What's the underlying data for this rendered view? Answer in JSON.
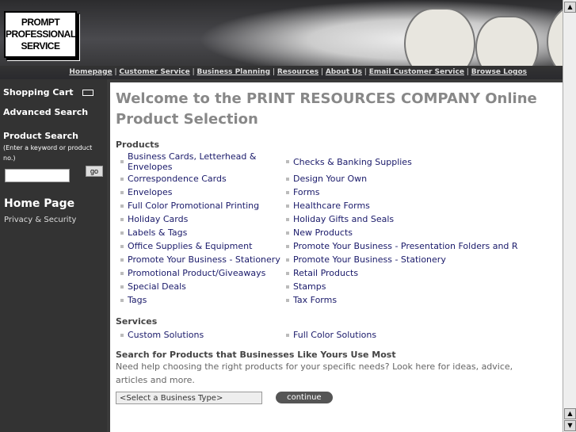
{
  "logo": {
    "text": [
      "PROMPT",
      "PROFESSIONAL",
      "SERVICE"
    ]
  },
  "nav": [
    "Homepage",
    "Customer Service",
    "Business Planning",
    "Resources",
    "About Us",
    "Email Customer Service",
    "Browse Logos"
  ],
  "sidebar": {
    "cart": "Shopping Cart",
    "advanced": "Advanced Search",
    "search_title": "Product Search",
    "search_hint": "(Enter a keyword or product no.)",
    "search_value": "",
    "go": "go",
    "home": "Home Page",
    "privacy": "Privacy & Security"
  },
  "main": {
    "title": "Welcome to the PRINT RESOURCES COMPANY Online Product Selection",
    "products_heading": "Products",
    "products": [
      "Business Cards, Letterhead & Envelopes",
      "Checks & Banking Supplies",
      "Correspondence Cards",
      "Design Your Own",
      "Envelopes",
      "Forms",
      "Full Color Promotional Printing",
      "Healthcare Forms",
      "Holiday Cards",
      "Holiday Gifts and Seals",
      "Labels & Tags",
      "New Products",
      "Office Supplies & Equipment",
      "Promote Your Business - Presentation Folders and R",
      "Promote Your Business - Stationery",
      "Promote Your Business - Stationery",
      "Promotional Product/Giveaways",
      "Retail Products",
      "Special Deals",
      "Stamps",
      "Tags",
      "Tax Forms"
    ],
    "services_heading": "Services",
    "services": [
      "Custom Solutions",
      "Full Color Solutions"
    ],
    "search_heading": "Search for Products that Businesses Like Yours Use Most",
    "search_text": "Need help choosing the right products for your specific needs? Look here for ideas, advice, articles and more.",
    "select_value": "<Select a Business Type>",
    "continue": "continue"
  }
}
